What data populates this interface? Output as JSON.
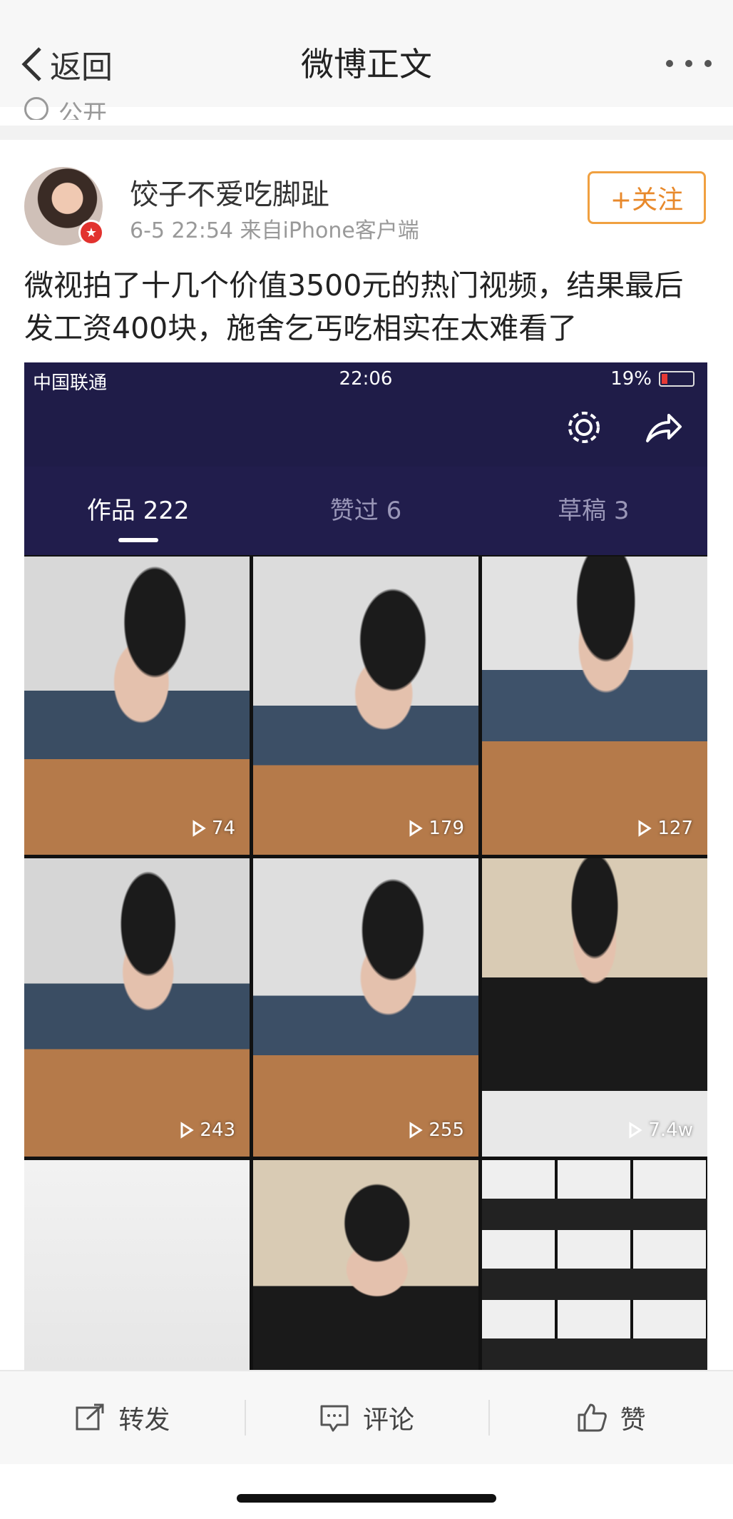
{
  "nav": {
    "back_label": "返回",
    "title": "微博正文"
  },
  "visibility_label": "公开",
  "post": {
    "username": "饺子不爱吃脚趾",
    "meta": "6-5 22:54  来自iPhone客户端",
    "follow_label": "+关注",
    "text": "微视拍了十几个价值3500元的热门视频，结果最后发工资400块，施舍乞丐吃相实在太难看了"
  },
  "embedded_screenshot": {
    "status_bar": {
      "carrier": "中国联通",
      "time": "22:06",
      "battery": "19%"
    },
    "tabs": [
      {
        "label": "作品 222",
        "active": true
      },
      {
        "label": "赞过 6",
        "active": false
      },
      {
        "label": "草稿 3",
        "active": false
      }
    ],
    "videos": [
      {
        "plays": "74"
      },
      {
        "plays": "179"
      },
      {
        "plays": "127"
      },
      {
        "plays": "243"
      },
      {
        "plays": "255"
      },
      {
        "plays": "7.4w"
      },
      {
        "plays": ""
      },
      {
        "plays": ""
      },
      {
        "plays": ""
      }
    ]
  },
  "actions": {
    "repost": "转发",
    "comment": "评论",
    "like": "赞"
  },
  "colors": {
    "follow_accent": "#e8892b",
    "screenshot_bg": "#1f1c48"
  }
}
